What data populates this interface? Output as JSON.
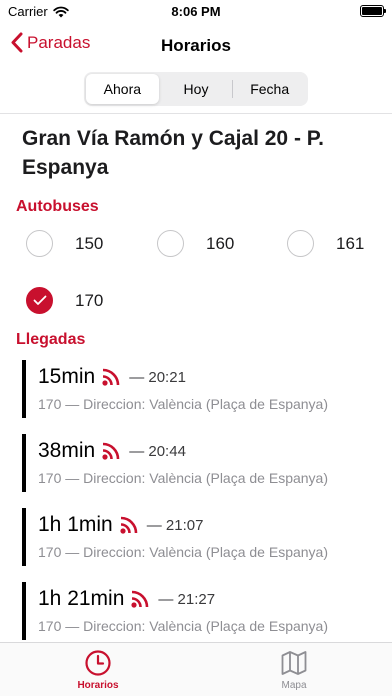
{
  "status_bar": {
    "carrier": "Carrier",
    "time": "8:06 PM",
    "battery_level": 1.0
  },
  "nav": {
    "back_label": "Paradas",
    "title": "Horarios"
  },
  "segments": [
    "Ahora",
    "Hoy",
    "Fecha"
  ],
  "active_segment": "Ahora",
  "stop_name": "Gran Vía Ramón y Cajal 20 - P. Espanya",
  "buses": {
    "header": "Autobuses",
    "options": [
      {
        "label": "150",
        "checked": false
      },
      {
        "label": "160",
        "checked": false
      },
      {
        "label": "161",
        "checked": false
      },
      {
        "label": "170",
        "checked": true
      }
    ]
  },
  "arrivals": {
    "header": "Llegadas",
    "items": [
      {
        "eta": "15min",
        "time": "— 20:21",
        "detail": "170 — Direccion: València (Plaça de Espanya)"
      },
      {
        "eta": "38min",
        "time": "— 20:44",
        "detail": "170 — Direccion: València (Plaça de Espanya)"
      },
      {
        "eta": "1h 1min",
        "time": "— 21:07",
        "detail": "170 — Direccion: València (Plaça de Espanya)"
      },
      {
        "eta": "1h 21min",
        "time": "— 21:27",
        "detail": "170 — Direccion: València (Plaça de Espanya)"
      }
    ]
  },
  "tabs": [
    {
      "label": "Horarios",
      "icon": "clock-icon",
      "active": true
    },
    {
      "label": "Mapa",
      "icon": "map-icon",
      "active": false
    }
  ],
  "colors": {
    "accent": "#c8102e",
    "realtime_icon": "#c8102e"
  }
}
